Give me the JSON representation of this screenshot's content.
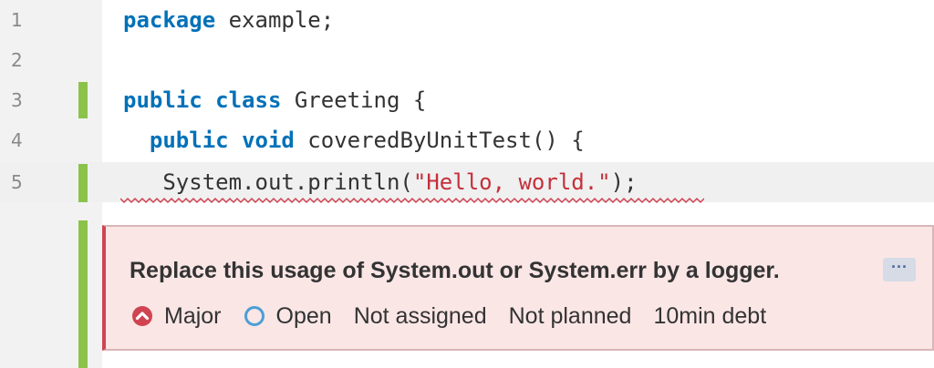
{
  "lines": [
    {
      "number": "1",
      "tokens": [
        {
          "type": "kw",
          "text": "package"
        },
        {
          "type": "plain",
          "text": " example;"
        }
      ]
    },
    {
      "number": "2",
      "tokens": []
    },
    {
      "number": "3",
      "tokens": [
        {
          "type": "kw",
          "text": "public"
        },
        {
          "type": "plain",
          "text": " "
        },
        {
          "type": "kw",
          "text": "class"
        },
        {
          "type": "plain",
          "text": " Greeting {"
        }
      ]
    },
    {
      "number": "4",
      "tokens": [
        {
          "type": "plain",
          "text": "  "
        },
        {
          "type": "kw",
          "text": "public"
        },
        {
          "type": "plain",
          "text": " "
        },
        {
          "type": "kw",
          "text": "void"
        },
        {
          "type": "plain",
          "text": " coveredByUnitTest() {"
        }
      ]
    },
    {
      "number": "5",
      "tokens": [
        {
          "type": "plain",
          "text": "   System.out.println("
        },
        {
          "type": "str",
          "text": "\"Hello, world.\""
        },
        {
          "type": "plain",
          "text": ");"
        }
      ]
    }
  ],
  "issue": {
    "message": "Replace this usage of System.out or System.err by a logger.",
    "more_label": "···",
    "severity": "Major",
    "status": "Open",
    "assignee": "Not assigned",
    "plan": "Not planned",
    "debt": "10min debt"
  },
  "colors": {
    "coverage": "#8bc34a",
    "keyword": "#0071b8",
    "string": "#c4303a",
    "issue_bg": "#fbe6e6",
    "issue_accent": "#d04452",
    "status_open": "#4b9fd5"
  },
  "icons": {
    "severity": "major-severity-icon",
    "status": "open-status-icon"
  }
}
